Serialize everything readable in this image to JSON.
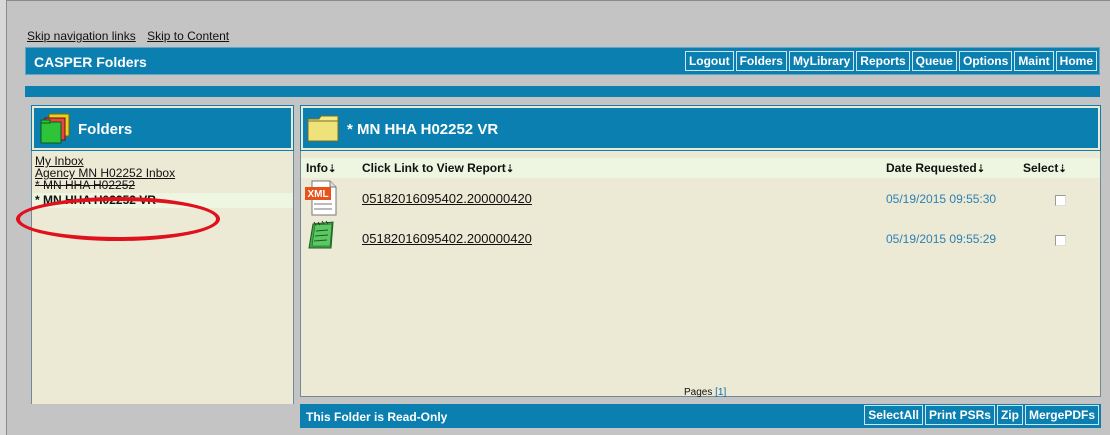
{
  "skip_links": [
    "Skip navigation links",
    "Skip to Content"
  ],
  "app_title": "CASPER Folders",
  "top_nav": [
    "Logout",
    "Folders",
    "MyLibrary",
    "Reports",
    "Queue",
    "Options",
    "Maint",
    "Home"
  ],
  "left_panel": {
    "title": "Folders",
    "items": [
      "My Inbox",
      "Agency MN H02252 Inbox",
      "* MN HHA H02252",
      "* MN HHA H02252 VR"
    ]
  },
  "main_panel": {
    "title": "* MN HHA H02252 VR",
    "columns": {
      "info": "Info",
      "report": "Click Link to View Report",
      "date": "Date Requested",
      "select": "Select"
    },
    "rows": [
      {
        "icon": "xml-file-icon",
        "icon_label": "XML",
        "name": "05182016095402.200000420",
        "date": "05/19/2015 09:55:30"
      },
      {
        "icon": "notepad-icon",
        "icon_label": "",
        "name": "05182016095402.200000420",
        "date": "05/19/2015 09:55:29"
      }
    ],
    "pages_label": "Pages",
    "pages_link": "[1]"
  },
  "bottom_bar": {
    "status": "This Folder is Read-Only",
    "buttons": [
      "SelectAll",
      "Print PSRs",
      "Zip",
      "MergePDFs"
    ]
  },
  "colors": {
    "header_blue": "#0a7fb0",
    "panel_bg": "#ece9d4",
    "highlight": "#e0101c",
    "date_blue": "#2d80b5"
  },
  "sort_glyph": "⇣"
}
